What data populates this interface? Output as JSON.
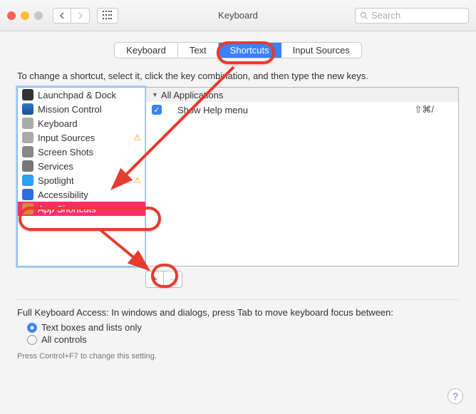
{
  "window": {
    "title": "Keyboard"
  },
  "toolbar": {
    "search_placeholder": "Search"
  },
  "tabs": [
    {
      "label": "Keyboard"
    },
    {
      "label": "Text"
    },
    {
      "label": "Shortcuts",
      "selected": true
    },
    {
      "label": "Input Sources"
    }
  ],
  "instruction": "To change a shortcut, select it, click the key combination, and then type the new keys.",
  "categories": [
    {
      "label": "Launchpad & Dock",
      "iconClass": "ic1"
    },
    {
      "label": "Mission Control",
      "iconClass": "ic2"
    },
    {
      "label": "Keyboard",
      "iconClass": "ic3"
    },
    {
      "label": "Input Sources",
      "iconClass": "ic4",
      "warning": true
    },
    {
      "label": "Screen Shots",
      "iconClass": "ic5"
    },
    {
      "label": "Services",
      "iconClass": "ic6"
    },
    {
      "label": "Spotlight",
      "iconClass": "ic7",
      "warning": true
    },
    {
      "label": "Accessibility",
      "iconClass": "ic8"
    },
    {
      "label": "App Shortcuts",
      "iconClass": "ic9",
      "selected": true
    }
  ],
  "shortcuts": {
    "group_label": "All Applications",
    "items": [
      {
        "enabled": true,
        "name": "Show Help menu",
        "keys": "⇧⌘/"
      }
    ]
  },
  "buttons": {
    "add": "+",
    "remove": "−"
  },
  "full_keyboard_access": {
    "text": "Full Keyboard Access: In windows and dialogs, press Tab to move keyboard focus between:",
    "opt1": "Text boxes and lists only",
    "opt2": "All controls",
    "tip": "Press Control+F7 to change this setting."
  }
}
